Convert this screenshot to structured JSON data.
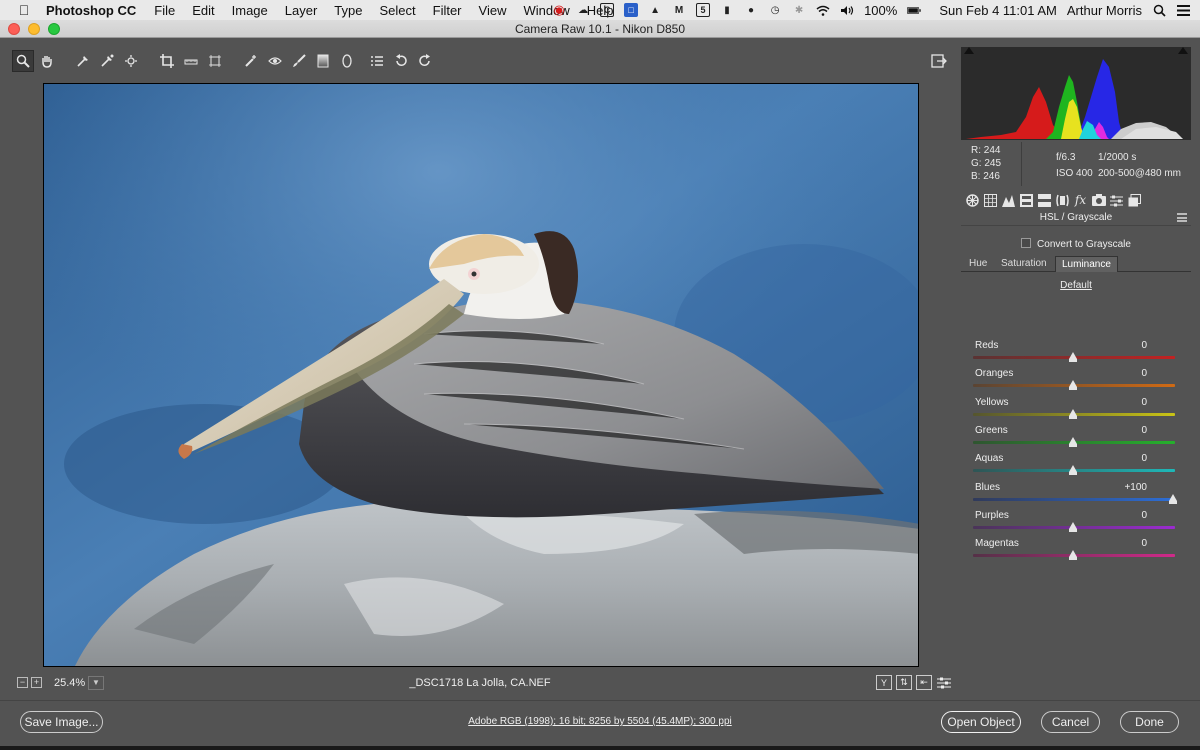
{
  "menubar": {
    "apple_icon": "apple-logo",
    "app_name": "Photoshop CC",
    "items": [
      "File",
      "Edit",
      "Image",
      "Layer",
      "Type",
      "Select",
      "Filter",
      "View",
      "Window",
      "Help"
    ],
    "battery": "100%",
    "datetime": "Sun Feb 4  11:01 AM",
    "user": "Arthur Morris"
  },
  "window": {
    "title": "Camera Raw 10.1  -  Nikon D850"
  },
  "preview": {
    "zoom": "25.4%",
    "filename": "_DSC1718  La  Jolla, CA.NEF",
    "view_buttons": [
      "Y",
      "",
      "",
      ""
    ]
  },
  "info": {
    "r": "R:  244",
    "g": "G:  245",
    "b": "B:  246",
    "aperture": "f/6.3",
    "shutter": "1/2000 s",
    "iso": "ISO 400",
    "lens": "200-500@480 mm"
  },
  "panel": {
    "title": "HSL / Grayscale",
    "convert_label": "Convert to Grayscale",
    "tabs": [
      "Hue",
      "Saturation",
      "Luminance"
    ],
    "active_tab": "Luminance",
    "default_label": "Default",
    "sliders": [
      {
        "label": "Reds",
        "value": "0",
        "level": 0
      },
      {
        "label": "Oranges",
        "value": "0",
        "level": 0
      },
      {
        "label": "Yellows",
        "value": "0",
        "level": 0
      },
      {
        "label": "Greens",
        "value": "0",
        "level": 0
      },
      {
        "label": "Aquas",
        "value": "0",
        "level": 0
      },
      {
        "label": "Blues",
        "value": "+100",
        "level": 100
      },
      {
        "label": "Purples",
        "value": "0",
        "level": 0
      },
      {
        "label": "Magentas",
        "value": "0",
        "level": 0
      }
    ]
  },
  "bottom": {
    "save_label": "Save Image...",
    "workflow": "Adobe RGB (1998); 16 bit; 8256 by 5504 (45.4MP); 300 ppi",
    "open_label": "Open Object",
    "cancel_label": "Cancel",
    "done_label": "Done"
  }
}
